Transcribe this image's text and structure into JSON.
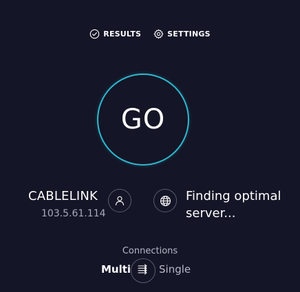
{
  "nav": {
    "results_label": "RESULTS",
    "settings_label": "SETTINGS"
  },
  "go_button": {
    "label": "GO"
  },
  "provider": {
    "name": "CABLELINK",
    "ip": "103.5.61.114"
  },
  "server": {
    "status_line1": "Finding optimal",
    "status_line2": "server..."
  },
  "connections": {
    "title": "Connections",
    "multi_label": "Multi",
    "single_label": "Single",
    "selected": "Multi"
  },
  "colors": {
    "background": "#141526",
    "accent": "#2fb9cf",
    "muted_text": "#a8aabd"
  },
  "icons": {
    "results": "check-circle-icon",
    "settings": "gear-icon",
    "user": "user-icon",
    "globe": "globe-icon",
    "connections": "arrows-icon"
  }
}
